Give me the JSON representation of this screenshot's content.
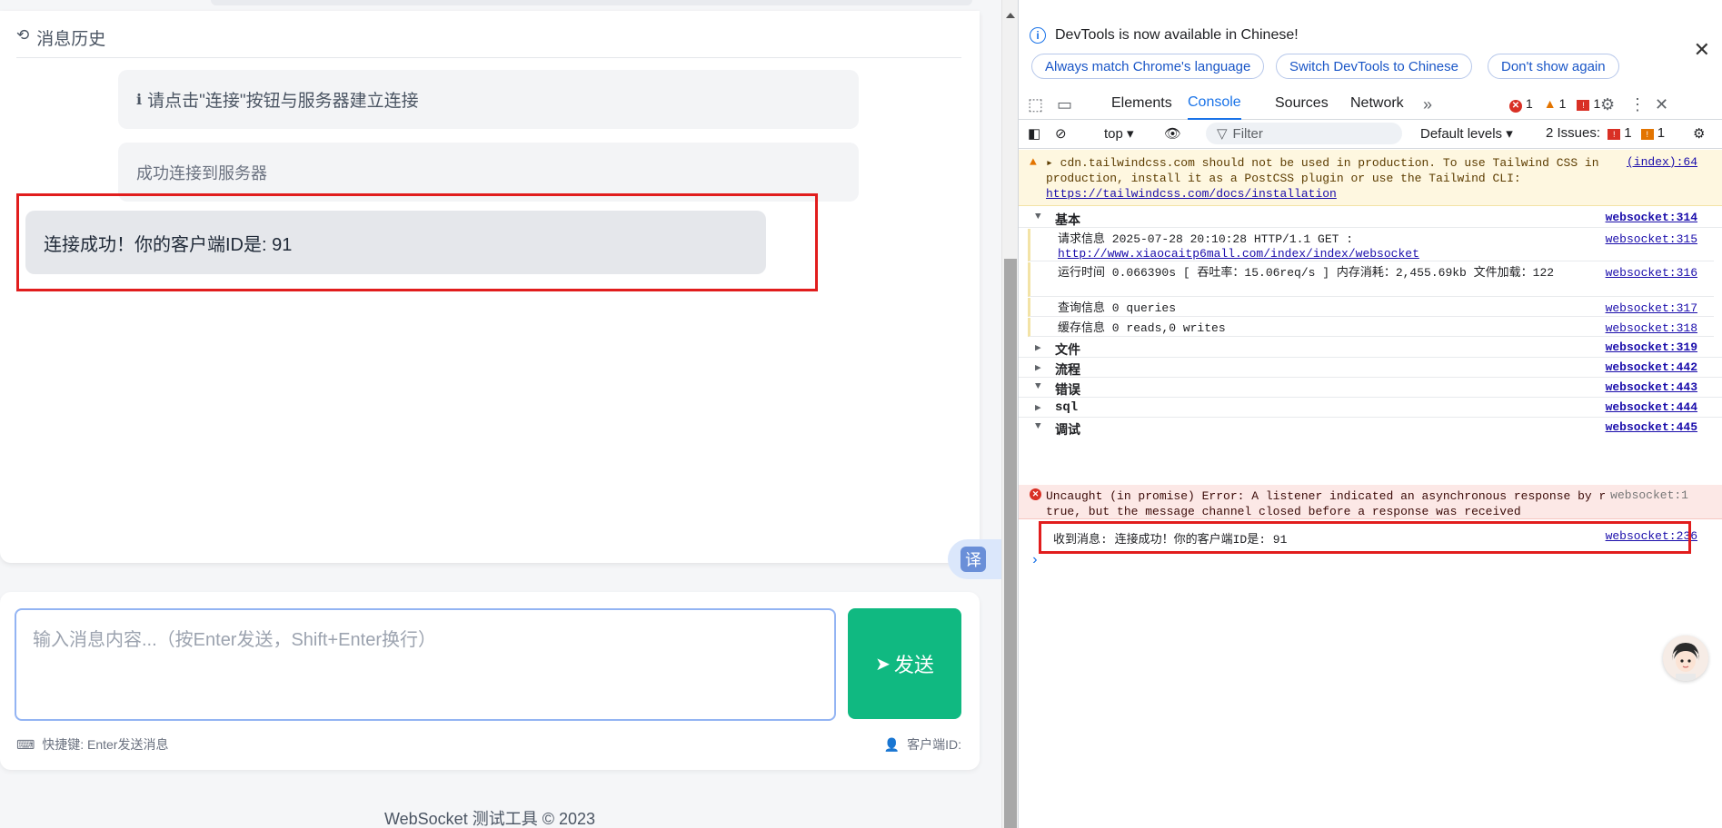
{
  "page": {
    "history_title": "消息历史",
    "messages": [
      "请点击\"连接\"按钮与服务器建立连接",
      "成功连接到服务器",
      "连接成功！你的客户端ID是: 91"
    ],
    "translate_label": "译",
    "input_placeholder": "输入消息内容...（按Enter发送，Shift+Enter换行）",
    "send_label": "发送",
    "shortcut_hint": "快捷键: Enter发送消息",
    "client_id_label": "客户端ID:",
    "footer": "WebSocket 测试工具 © 2023"
  },
  "devtools": {
    "notice": "DevTools is now available in Chinese!",
    "notice_buttons": [
      "Always match Chrome's language",
      "Switch DevTools to Chinese",
      "Don't show again"
    ],
    "tabs": [
      "Elements",
      "Console",
      "Sources",
      "Network"
    ],
    "active_tab": "Console",
    "error_count": "1",
    "warning_count": "1",
    "issue_flag_count": "1",
    "context": "top",
    "filter_placeholder": "Filter",
    "levels": "Default levels",
    "issues_label": "2 Issues:",
    "issues_err": "1",
    "issues_warn": "1",
    "warning": {
      "text1": "cdn.tailwindcss.com should not be used in production. To use Tailwind CSS in production, install it as a PostCSS plugin or use the Tailwind CLI:",
      "link": "https://tailwindcss.com/docs/installation",
      "source": "(index):64"
    },
    "groups": [
      {
        "label": "基本",
        "source": "websocket:314"
      },
      {
        "label": "文件",
        "source": "websocket:319"
      },
      {
        "label": "流程",
        "source": "websocket:442"
      },
      {
        "label": "错误",
        "source": "websocket:443"
      },
      {
        "label": "sql",
        "source": "websocket:444"
      },
      {
        "label": "调试",
        "source": "websocket:445"
      }
    ],
    "sub_rows": [
      {
        "text": "请求信息 2025-07-28 20:10:28 HTTP/1.1 GET :",
        "link": "http://www.xiaocaitp6mall.com/index/index/websocket",
        "source": "websocket:315"
      },
      {
        "text": "运行时间 0.066390s [ 吞吐率：15.06req/s ] 内存消耗：2,455.69kb 文件加载：122",
        "source": "websocket:316"
      },
      {
        "text": "查询信息 0 queries",
        "source": "websocket:317"
      },
      {
        "text": "缓存信息 0 reads,0 writes",
        "source": "websocket:318"
      }
    ],
    "error": {
      "text": "Uncaught (in promise) Error: A listener indicated an asynchronous response by returning true, but the message channel closed before a response was received",
      "source": "websocket:1"
    },
    "received": {
      "text": "收到消息: 连接成功！你的客户端ID是: 91",
      "source": "websocket:236"
    }
  }
}
